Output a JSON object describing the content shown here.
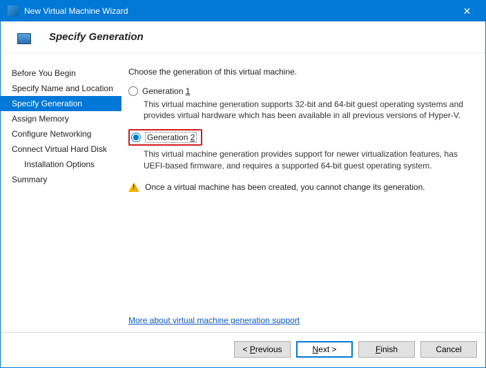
{
  "window": {
    "title": "New Virtual Machine Wizard",
    "header": "Specify Generation"
  },
  "sidebar": {
    "items": [
      {
        "label": "Before You Begin"
      },
      {
        "label": "Specify Name and Location"
      },
      {
        "label": "Specify Generation"
      },
      {
        "label": "Assign Memory"
      },
      {
        "label": "Configure Networking"
      },
      {
        "label": "Connect Virtual Hard Disk"
      },
      {
        "label": "Installation Options"
      },
      {
        "label": "Summary"
      }
    ]
  },
  "content": {
    "prompt": "Choose the generation of this virtual machine.",
    "gen1": {
      "label_prefix": "Generation ",
      "label_accel": "1",
      "desc": "This virtual machine generation supports 32-bit and 64-bit guest operating systems and provides virtual hardware which has been available in all previous versions of Hyper-V."
    },
    "gen2": {
      "label_prefix": "Generation ",
      "label_accel": "2",
      "desc": "This virtual machine generation provides support for newer virtualization features, has UEFI-based firmware, and requires a supported 64-bit guest operating system."
    },
    "warning": "Once a virtual machine has been created, you cannot change its generation.",
    "link": "More about virtual machine generation support"
  },
  "buttons": {
    "previous_prefix": "< ",
    "previous_accel": "P",
    "previous_suffix": "revious",
    "next_accel": "N",
    "next_suffix": "ext >",
    "finish_accel": "F",
    "finish_suffix": "inish",
    "cancel": "Cancel"
  }
}
